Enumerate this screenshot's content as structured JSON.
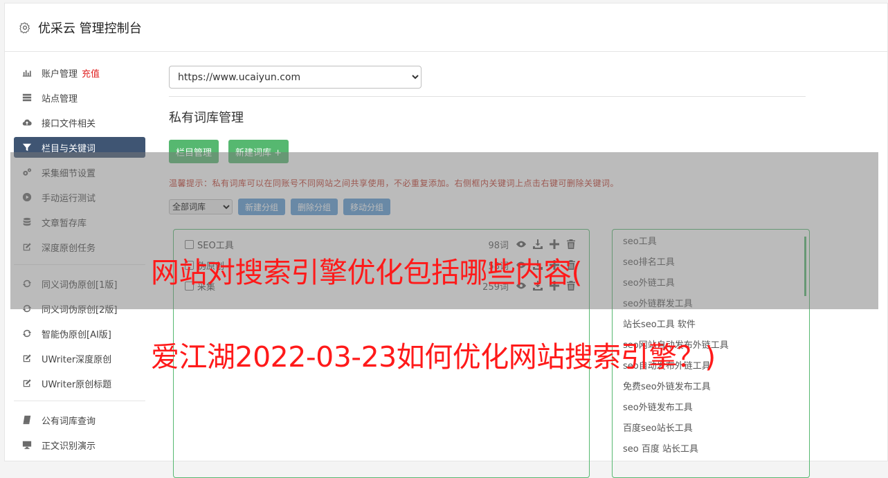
{
  "header": {
    "title": "优采云 管理控制台"
  },
  "sidebar": {
    "items": [
      {
        "label": "账户管理",
        "badge": "充值",
        "icon": "bar-chart-icon"
      },
      {
        "label": "站点管理",
        "icon": "server-icon"
      },
      {
        "label": "接口文件相关",
        "icon": "cloud-upload-icon"
      },
      {
        "label": "栏目与关键词",
        "icon": "filter-icon",
        "active": true
      },
      {
        "label": "采集细节设置",
        "icon": "gears-icon"
      },
      {
        "label": "手动运行测试",
        "icon": "play-circle-icon"
      },
      {
        "label": "文章暂存库",
        "icon": "database-icon"
      },
      {
        "label": "深度原创任务",
        "icon": "edit-icon"
      }
    ],
    "items2": [
      {
        "label": "同义词伪原创[1版]",
        "icon": "refresh-icon"
      },
      {
        "label": "同义词伪原创[2版]",
        "icon": "refresh-icon"
      },
      {
        "label": "智能伪原创[AI版]",
        "icon": "refresh-icon"
      },
      {
        "label": "UWriter深度原创",
        "icon": "edit-icon"
      },
      {
        "label": "UWriter原创标题",
        "icon": "edit-icon"
      }
    ],
    "items3": [
      {
        "label": "公有词库查询",
        "icon": "book-icon"
      },
      {
        "label": "正文识别演示",
        "icon": "monitor-icon"
      }
    ]
  },
  "main": {
    "site_selected": "https://www.ucaiyun.com",
    "section_title": "私有词库管理",
    "btn_column": "栏目管理",
    "btn_new_dict": "新建词库 +",
    "tip": "温馨提示：私有词库可以在同账号不同网站之间共享使用，不必重复添加。右侧框内关键词上点击右键可删除关键词。",
    "filter_selected": "全部词库",
    "btn_new_group": "新建分组",
    "btn_del_group": "删除分组",
    "btn_move_group": "移动分组"
  },
  "dicts": [
    {
      "name": "SEO工具",
      "count": "98词"
    },
    {
      "name": "伪原创",
      "count": "58词"
    },
    {
      "name": "采集",
      "count": "259词"
    }
  ],
  "keywords": [
    "seo工具",
    "seo排名工具",
    "seo外链工具",
    "seo外链群发工具",
    "站长seo工具 软件",
    "seo网站自动发布外链工具",
    "seo自动发布外链工具",
    "免费seo外链发布工具",
    "seo外链发布工具",
    "百度seo站长工具",
    "seo 百度 站长工具"
  ],
  "overlay": {
    "line1": "网站对搜索引擎优化包括哪些内容(",
    "line2": "爱江湖2022-03-23如何优化网站搜索引擎？)"
  }
}
